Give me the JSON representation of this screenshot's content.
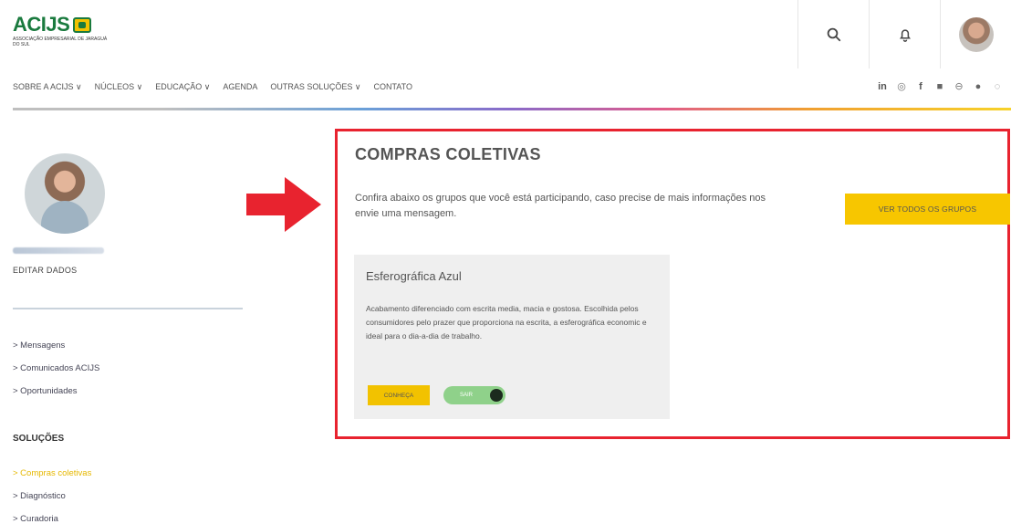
{
  "header": {
    "logo_text": "ACIJS",
    "logo_subtitle": "Associação Empresarial de Jaraguá do Sul",
    "icons": [
      "search-icon",
      "bell-icon",
      "avatar"
    ]
  },
  "nav": {
    "items": [
      "SOBRE A ACIJS ∨",
      "NÚCLEOS ∨",
      "EDUCAÇÃO ∨",
      "AGENDA",
      "OUTRAS SOLUÇÕES ∨",
      "CONTATO"
    ]
  },
  "social": {
    "icons": [
      "linkedin-icon",
      "instagram-icon",
      "facebook-icon",
      "youtube-icon",
      "flickr-icon",
      "spotify-icon",
      "whatsapp-icon"
    ],
    "glyphs": [
      "in",
      "◎",
      "f",
      "■",
      "⊖",
      "●",
      "◌"
    ]
  },
  "sidebar": {
    "edit_label": "EDITAR DADOS",
    "links": [
      "> Mensagens",
      "> Comunicados ACIJS",
      "> Oportunidades"
    ],
    "solutions_title": "SOLUÇÕES",
    "solutions": [
      "> Compras coletivas",
      "> Diagnóstico",
      "> Curadoria"
    ],
    "active_solution": "> Compras coletivas"
  },
  "main": {
    "title": "COMPRAS COLETIVAS",
    "description": "Confira abaixo os grupos que você está participando, caso precise de mais informações nos envie uma mensagem.",
    "view_all_label": "VER TODOS OS GRUPOS",
    "card": {
      "title": "Esferográfica Azul",
      "text": "Acabamento diferenciado com escrita media, macia e gostosa. Escolhida pelos consumidores pelo prazer que proporciona na escrita, a esferográfica economic e ideal para o dia-a-dia de trabalho.",
      "button_label": "CONHEÇA",
      "toggle_label": "SAIR"
    }
  },
  "colors": {
    "brand_green": "#1a7a3e",
    "brand_yellow": "#f7c600",
    "highlight_red": "#e8232f",
    "toggle_green": "#8fd18a"
  }
}
